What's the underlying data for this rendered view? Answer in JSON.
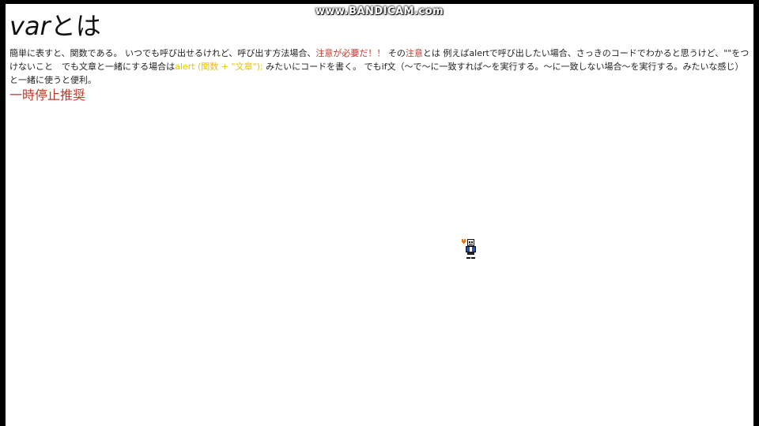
{
  "watermark": "www.BANDICAM.com",
  "page": {
    "title_en": "var",
    "title_ja": "とは",
    "paragraph": {
      "p1": "簡単に表すと、関数である。 いつでも呼び出せるけれど、呼び出す方法場合、",
      "p2_red": "注意が必要だ！！",
      "p3": " その",
      "p4_red": "注意",
      "p5": "とは 例えばalertで呼び出したい場合、さっきのコードでわかると思うけど、\"\"をつけないこと　でも文章と一緒にする場合は",
      "p6_yellow": "alert (関数 + \"文章\");",
      "p7": " みたいにコードを書く。 でもif文（～で～に一致すれば～を実行する。～に一致しない場合～を実行する。みたいな感じ）と一緒に使うと便利。"
    },
    "subheading": "一時停止推奨"
  },
  "colors": {
    "accent_red": "#c0392b",
    "accent_yellow": "#e6c200",
    "background": "#ffffff",
    "letterbox": "#000000"
  },
  "sprite": {
    "icon": "pixel-character-sprite"
  }
}
